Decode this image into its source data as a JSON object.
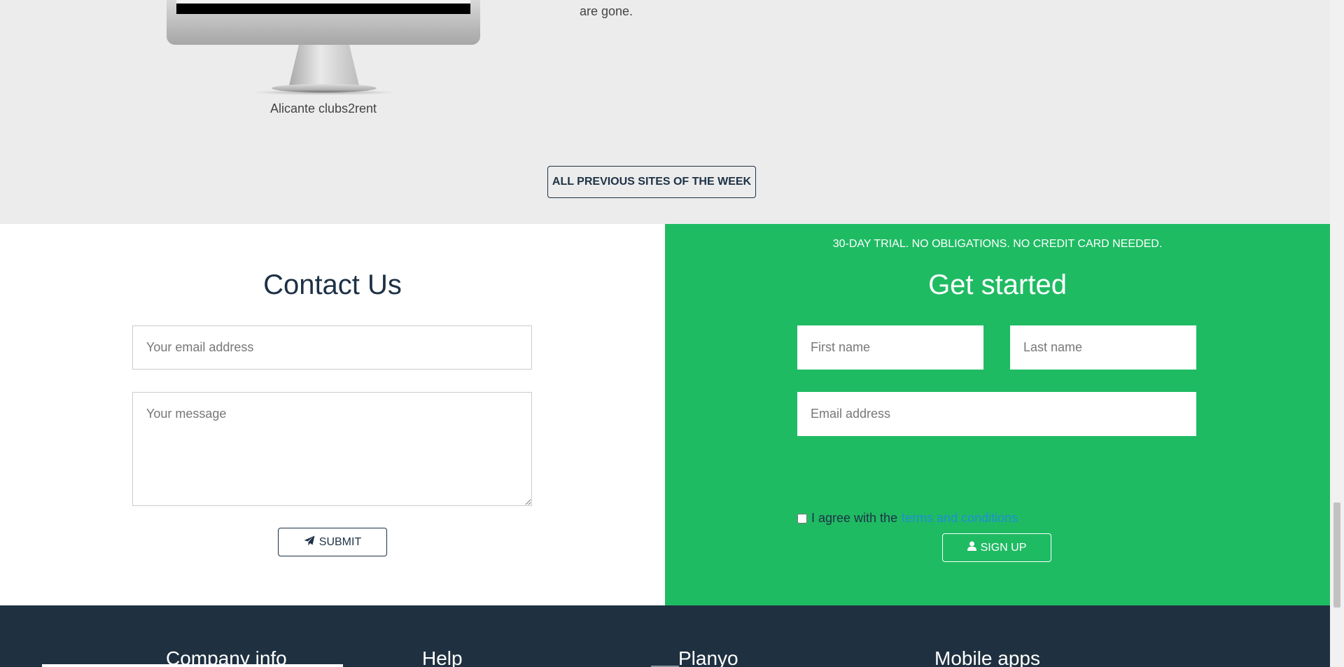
{
  "site_of_week": {
    "caption": "Alicante clubs2rent",
    "description_tail": "are gone.",
    "all_previous_label": "ALL PREVIOUS SITES OF THE WEEK"
  },
  "contact": {
    "title": "Contact Us",
    "email_placeholder": "Your email address",
    "message_placeholder": "Your message",
    "submit_label": "SUBMIT",
    "submit_icon": "paper-plane-icon"
  },
  "signup": {
    "trial_text": "30-DAY TRIAL. NO OBLIGATIONS. NO CREDIT CARD NEEDED.",
    "title": "Get started",
    "first_name_placeholder": "First name",
    "last_name_placeholder": "Last name",
    "email_placeholder": "Email address",
    "agree_text": "I agree with the",
    "terms_link": "terms and conditions",
    "button_label": "SIGN UP",
    "button_icon": "user-icon"
  },
  "footer": {
    "columns": [
      "Company info",
      "Help",
      "Planyo",
      "Mobile apps"
    ]
  },
  "colors": {
    "navy": "#1d3145",
    "green": "#1fbb63",
    "footer_bg": "#1f3140",
    "link": "#1f8fd4",
    "gray_bg": "#ececec"
  }
}
